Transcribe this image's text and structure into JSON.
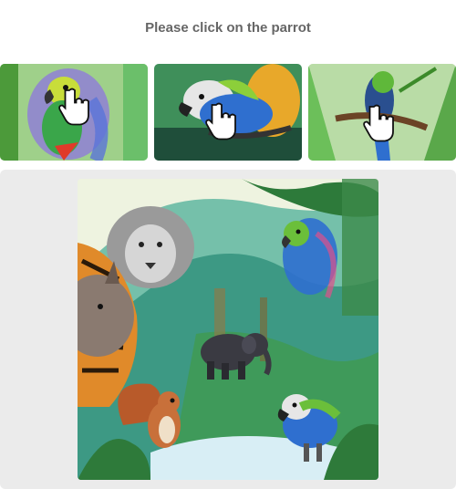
{
  "captcha": {
    "prompt": "Please click on the parrot"
  },
  "examples": [
    {
      "subject": "parrot",
      "cursor_icon": "hand-pointer-icon"
    },
    {
      "subject": "parrot",
      "cursor_icon": "hand-pointer-icon"
    },
    {
      "subject": "parrot",
      "cursor_icon": "hand-pointer-icon"
    }
  ],
  "scene": {
    "subjects": [
      "lion",
      "tiger",
      "rhino",
      "parrot",
      "elephant",
      "squirrel",
      "parrot"
    ],
    "colors": {
      "panel_bg": "#ebebeb",
      "prompt_text": "#666666",
      "jungle_green": "#2f8f5b",
      "parrot_blue": "#2f6fcf",
      "parrot_green": "#6bbf3a"
    }
  }
}
